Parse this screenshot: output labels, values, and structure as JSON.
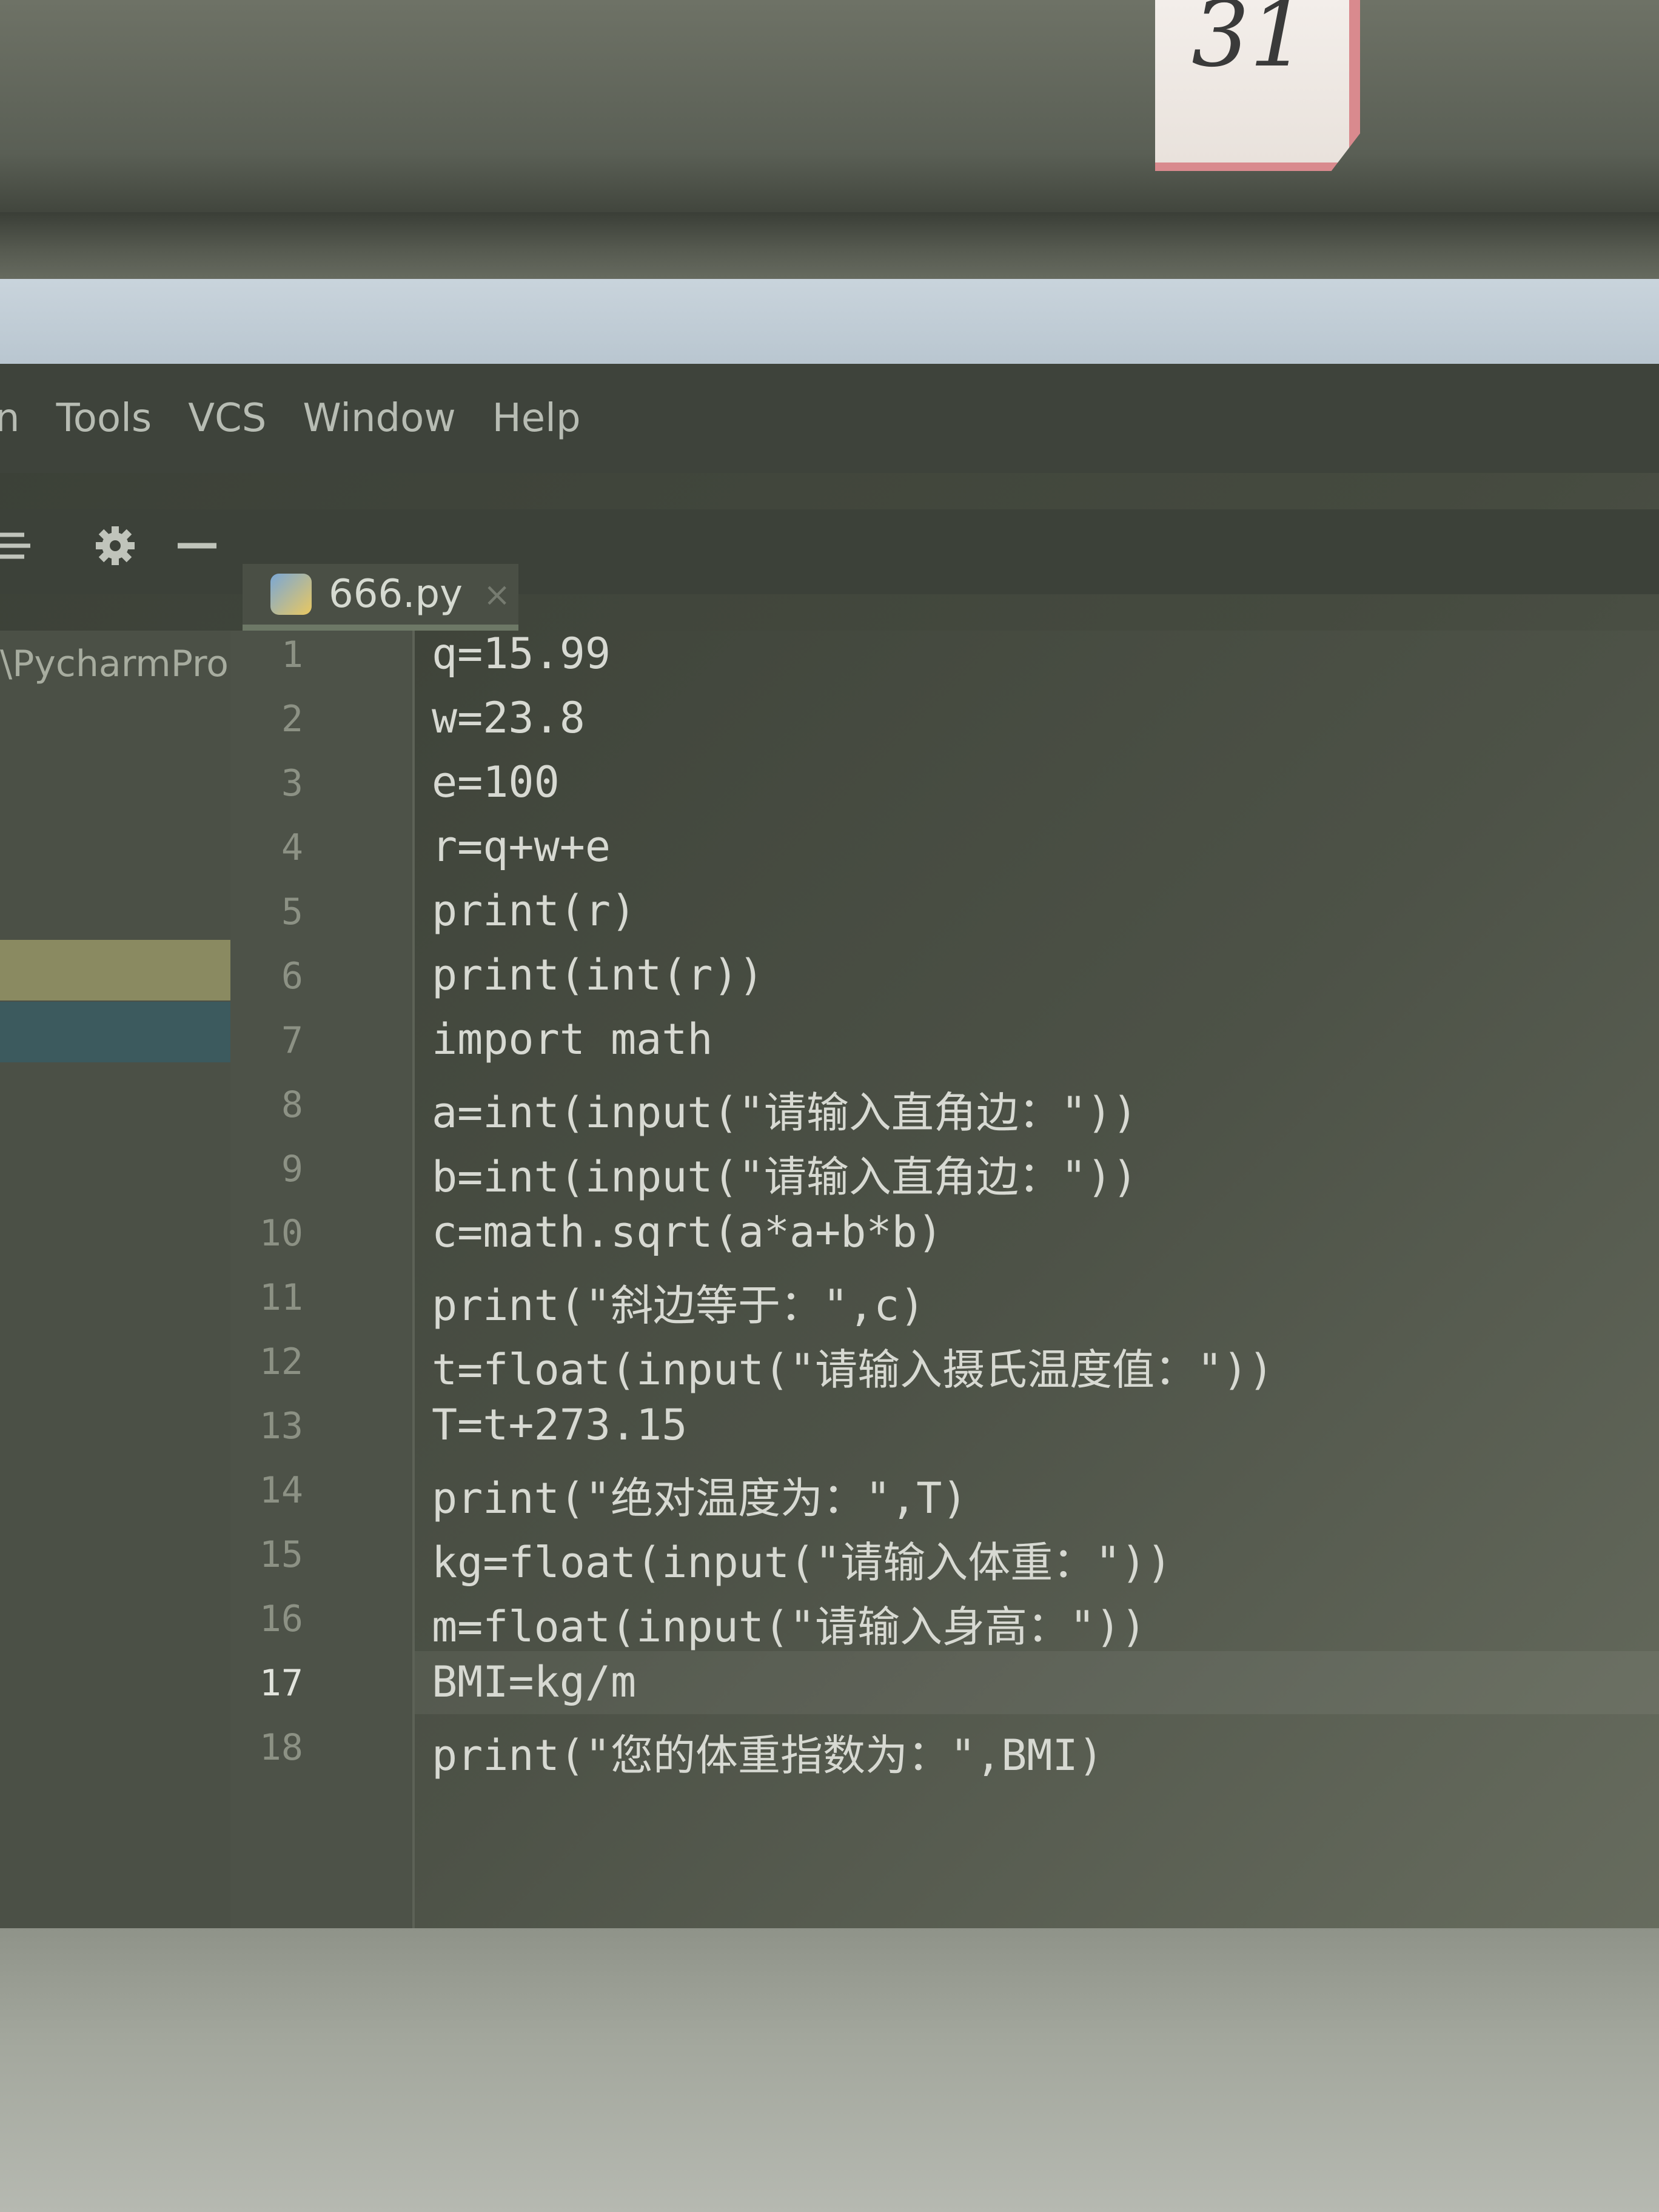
{
  "sticker": {
    "number": "31"
  },
  "menu": {
    "items": [
      {
        "label": "n"
      },
      {
        "label": "Tools"
      },
      {
        "label": "VCS"
      },
      {
        "label": "Window"
      },
      {
        "label": "Help"
      }
    ]
  },
  "toolbar": {
    "icons": [
      "collapse-all-icon",
      "gear-icon",
      "minimize-icon"
    ]
  },
  "tab": {
    "filename": "666.py",
    "close_glyph": "×"
  },
  "project": {
    "path": "\\PycharmPro"
  },
  "editor": {
    "current_line": 17,
    "lines": [
      {
        "num": "1",
        "text": "q=15.99"
      },
      {
        "num": "2",
        "text": "w=23.8"
      },
      {
        "num": "3",
        "text": "e=100"
      },
      {
        "num": "4",
        "text": "r=q+w+e"
      },
      {
        "num": "5",
        "text": "print(r)"
      },
      {
        "num": "6",
        "text": "print(int(r))"
      },
      {
        "num": "7",
        "text": "import math"
      },
      {
        "num": "8",
        "text": "a=int(input(\"请输入直角边：\"))"
      },
      {
        "num": "9",
        "text": "b=int(input(\"请输入直角边：\"))"
      },
      {
        "num": "10",
        "text": "c=math.sqrt(a*a+b*b)"
      },
      {
        "num": "11",
        "text": "print(\"斜边等于：\",c)"
      },
      {
        "num": "12",
        "text": "t=float(input(\"请输入摄氏温度值：\"))"
      },
      {
        "num": "13",
        "text": "T=t+273.15"
      },
      {
        "num": "14",
        "text": "print(\"绝对温度为：\",T)"
      },
      {
        "num": "15",
        "text": "kg=float(input(\"请输入体重：\"))"
      },
      {
        "num": "16",
        "text": "m=float(input(\"请输入身高：\"))"
      },
      {
        "num": "17",
        "text": "BMI=kg/m"
      },
      {
        "num": "18",
        "text": "print(\"您的体重指数为：\",BMI)"
      }
    ]
  }
}
